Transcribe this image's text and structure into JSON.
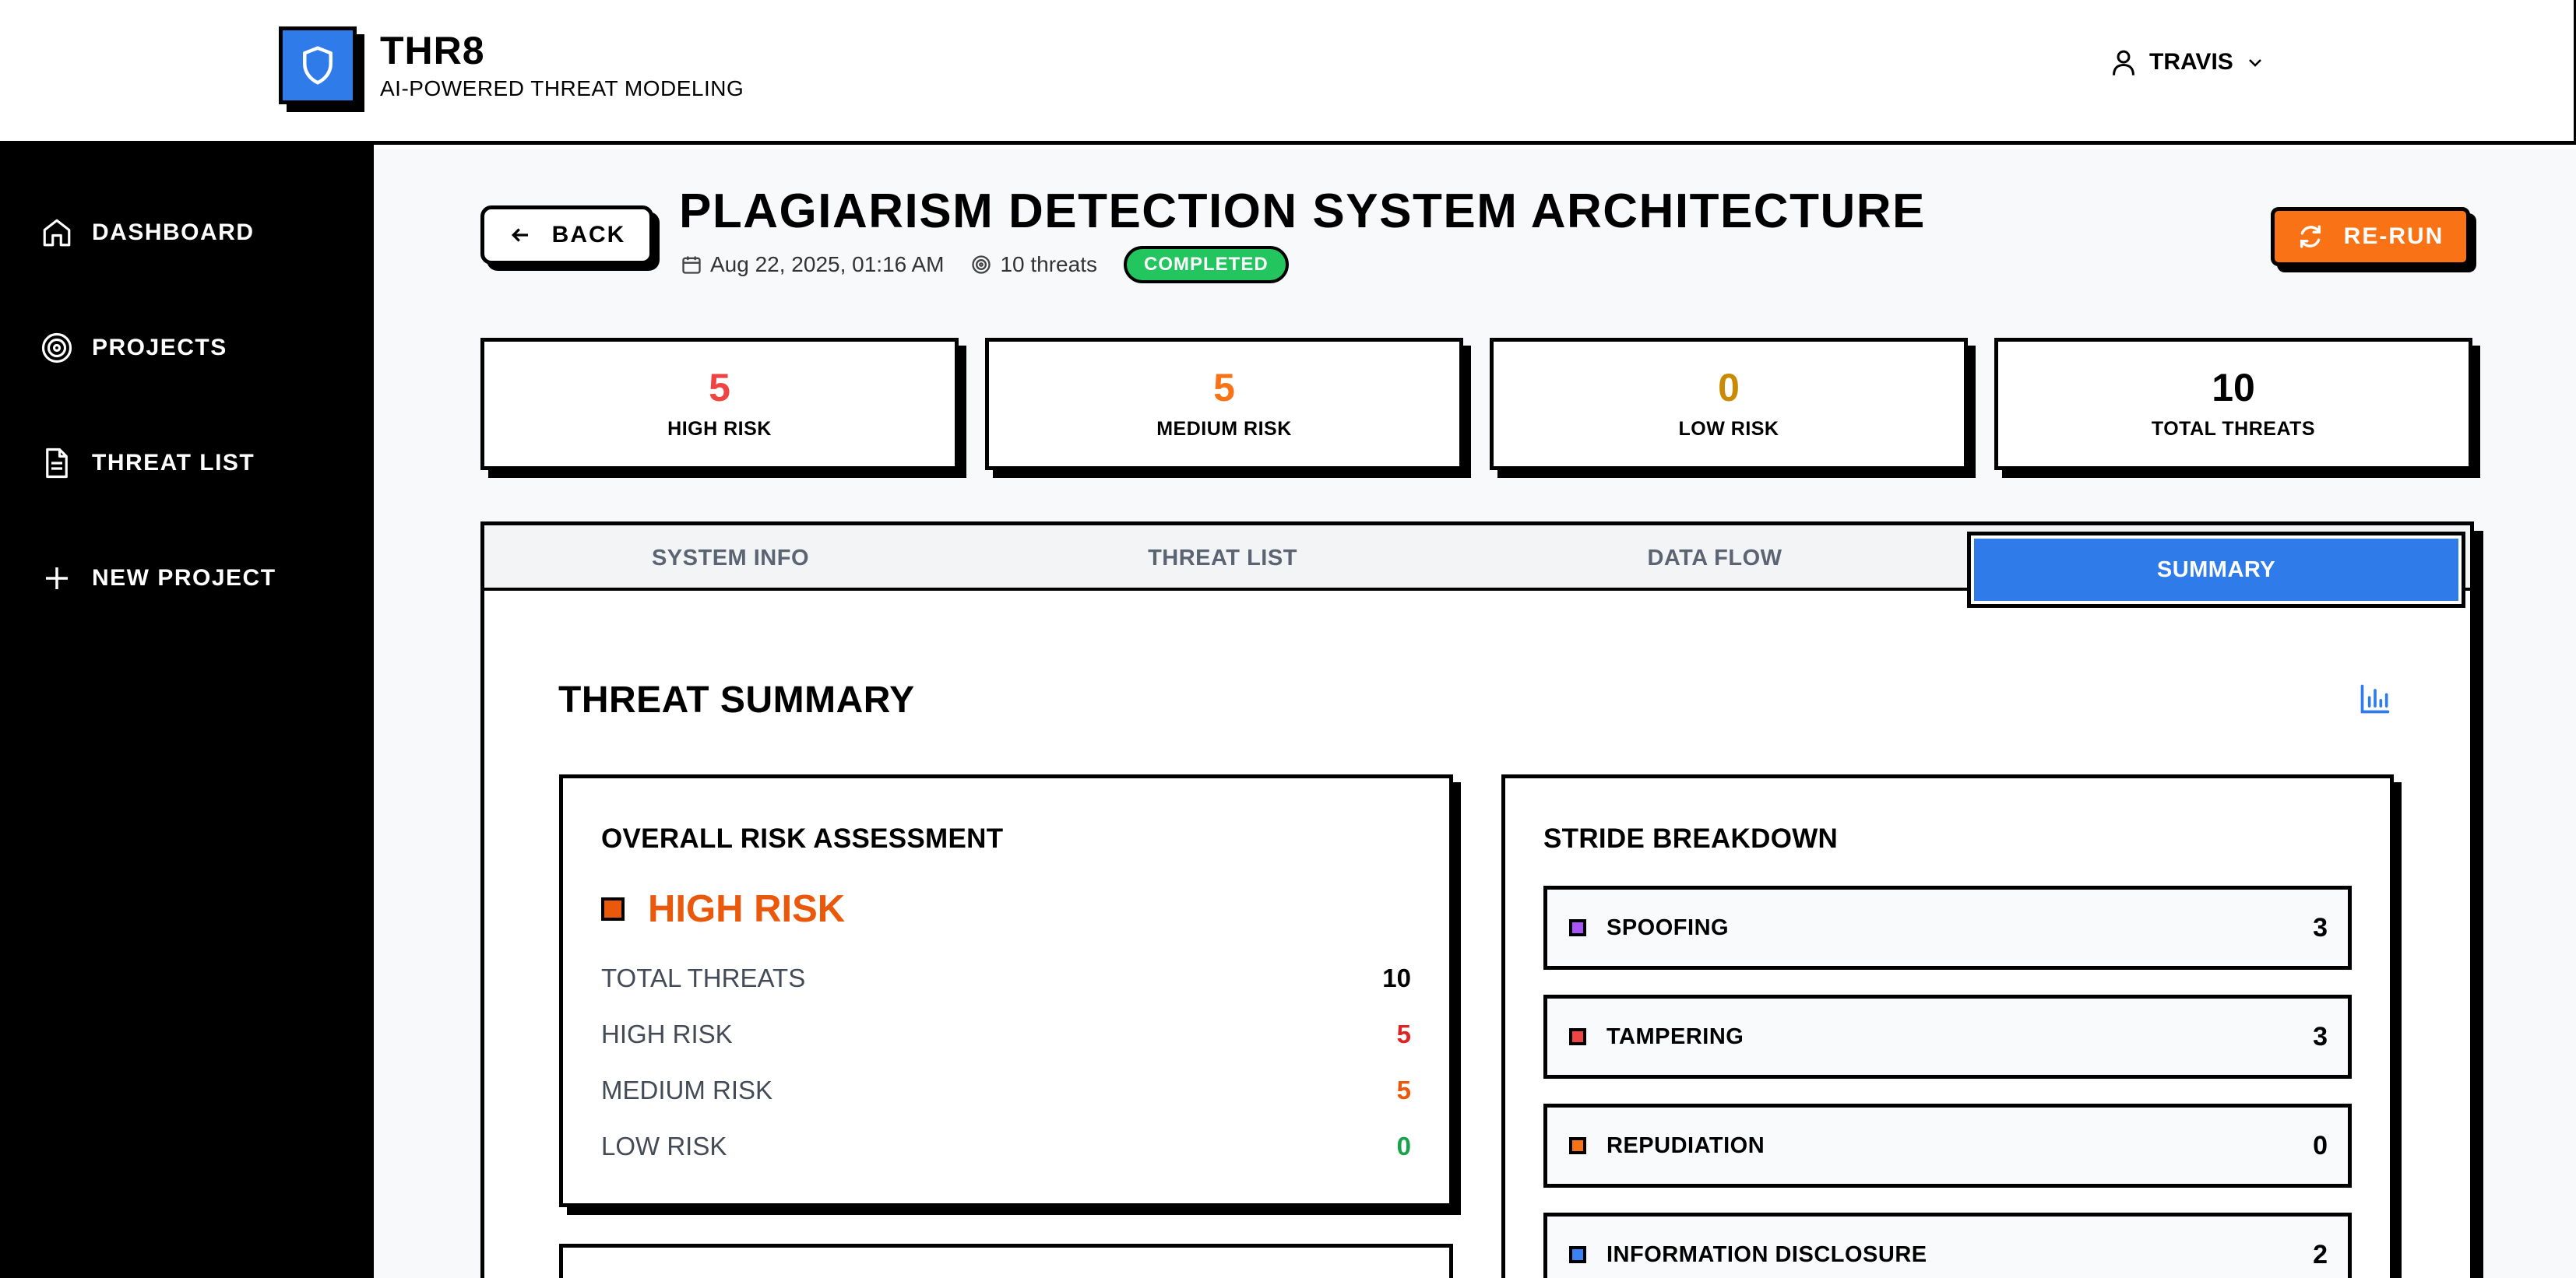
{
  "app": {
    "name": "THR8",
    "tagline": "AI-POWERED THREAT MODELING",
    "user": "TRAVIS"
  },
  "sidebar": {
    "items": [
      {
        "label": "DASHBOARD",
        "icon": "home-icon"
      },
      {
        "label": "PROJECTS",
        "icon": "target-icon"
      },
      {
        "label": "THREAT LIST",
        "icon": "document-icon"
      },
      {
        "label": "NEW PROJECT",
        "icon": "plus-icon"
      }
    ]
  },
  "page": {
    "back_label": "BACK",
    "title": "PLAGIARISM DETECTION SYSTEM ARCHITECTURE",
    "date": "Aug 22, 2025, 01:16 AM",
    "threat_count": "10 threats",
    "status": "COMPLETED",
    "rerun_label": "RE-RUN"
  },
  "stats": [
    {
      "value": "5",
      "label": "HIGH RISK",
      "color": "#ef4444"
    },
    {
      "value": "5",
      "label": "MEDIUM RISK",
      "color": "#f97316"
    },
    {
      "value": "0",
      "label": "LOW RISK",
      "color": "#ca8a04"
    },
    {
      "value": "10",
      "label": "TOTAL THREATS",
      "color": "#000000"
    }
  ],
  "tabs": [
    {
      "label": "SYSTEM INFO",
      "active": false
    },
    {
      "label": "THREAT LIST",
      "active": false
    },
    {
      "label": "DATA FLOW",
      "active": false
    },
    {
      "label": "SUMMARY",
      "active": true
    }
  ],
  "summary": {
    "title": "THREAT SUMMARY",
    "overall": {
      "title": "OVERALL RISK ASSESSMENT",
      "level": "HIGH RISK",
      "rows": [
        {
          "label": "TOTAL THREATS",
          "value": "10",
          "color": "#000000"
        },
        {
          "label": "HIGH RISK",
          "value": "5",
          "color": "#dc2626"
        },
        {
          "label": "MEDIUM RISK",
          "value": "5",
          "color": "#ea580c"
        },
        {
          "label": "LOW RISK",
          "value": "0",
          "color": "#16a34a"
        }
      ]
    },
    "stride": {
      "title": "STRIDE BREAKDOWN",
      "items": [
        {
          "label": "SPOOFING",
          "count": "3",
          "color": "#a855f7"
        },
        {
          "label": "TAMPERING",
          "count": "3",
          "color": "#ef4444"
        },
        {
          "label": "REPUDIATION",
          "count": "0",
          "color": "#f97316"
        },
        {
          "label": "INFORMATION DISCLOSURE",
          "count": "2",
          "color": "#3b82f6"
        }
      ]
    }
  }
}
